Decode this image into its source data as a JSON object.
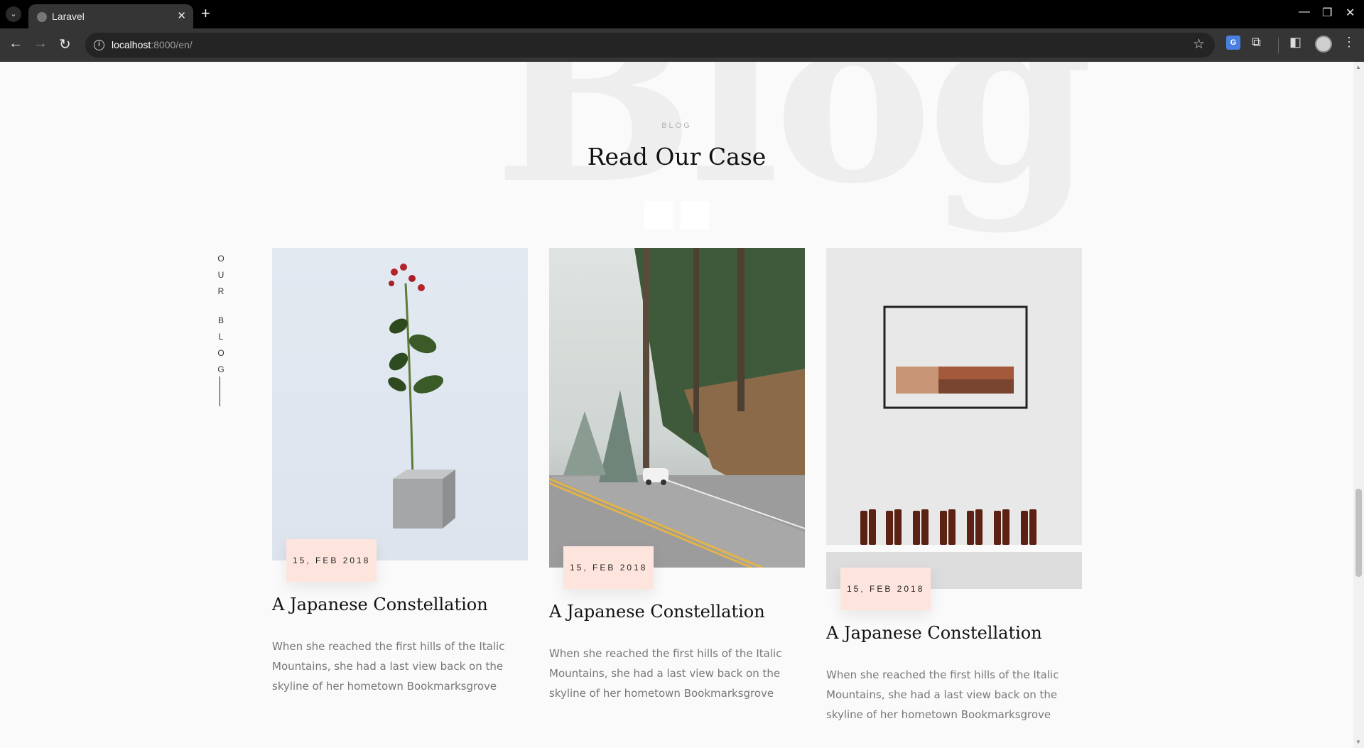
{
  "browser": {
    "tab_title": "Laravel",
    "tab_close": "✕",
    "new_tab": "+",
    "tab_dropdown": "⌄",
    "url_host": "localhost",
    "url_rest": ":8000/en/",
    "nav": {
      "back": "←",
      "forward": "→",
      "reload": "↻"
    },
    "controls": {
      "minimize": "—",
      "maximize": "❐",
      "close": "✕"
    },
    "bookmark": "☆",
    "menu": "⋮"
  },
  "section": {
    "watermark": "Blog",
    "eyebrow": "BLOG",
    "title": "Read Our Case",
    "side_label_top": [
      "O",
      "U",
      "R"
    ],
    "side_label_bottom": [
      "B",
      "L",
      "O",
      "G"
    ]
  },
  "posts": [
    {
      "date": "15, FEB 2018",
      "title": "A Japanese Constellation",
      "excerpt": "When she reached the first hills of the Italic Mountains, she had a last view back on the skyline of her hometown Bookmarksgrove"
    },
    {
      "date": "15, FEB 2018",
      "title": "A Japanese Constellation",
      "excerpt": "When she reached the first hills of the Italic Mountains, she had a last view back on the skyline of her hometown Bookmarksgrove"
    },
    {
      "date": "15, FEB 2018",
      "title": "A Japanese Constellation",
      "excerpt": "When she reached the first hills of the Italic Mountains, she had a last view back on the skyline of her hometown Bookmarksgrove"
    }
  ],
  "colors": {
    "badge": "#fde5de",
    "page_bg": "#fafafa",
    "chrome": "#353535"
  }
}
